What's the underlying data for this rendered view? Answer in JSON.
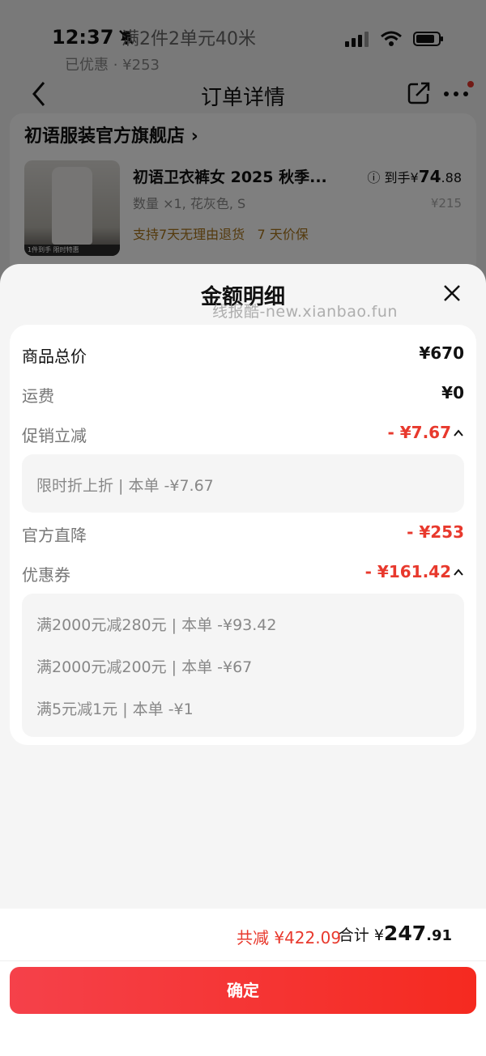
{
  "status_bar": {
    "time": "12:37",
    "ghost_text": "满2件2单元40米",
    "ghost_text2": "已优惠   ·   ¥253"
  },
  "nav": {
    "title": "订单详情"
  },
  "store": {
    "name": "初语服装官方旗舰店",
    "product": {
      "title": "初语卫衣裤女 2025 秋季...",
      "spec": "数量 ×1, 花灰色, S",
      "promo_return": "支持7天无理由退货",
      "promo_price": "7 天价保",
      "price_prefix": "到手",
      "price_currency": "¥",
      "price_int": "74",
      "price_dec": ".88",
      "original_price": "¥215",
      "image_tag": "1件到手 限时特惠"
    }
  },
  "sheet": {
    "title": "金额明细",
    "watermark": "线报酷-new.xianbao.fun",
    "rows": {
      "total_goods": {
        "label": "商品总价",
        "value": "¥670"
      },
      "shipping": {
        "label": "运费",
        "value": "¥0"
      },
      "promo": {
        "label": "促销立减",
        "value": "- ¥7.67"
      },
      "official": {
        "label": "官方直降",
        "value": "- ¥253"
      },
      "coupon": {
        "label": "优惠券",
        "value": "- ¥161.42"
      }
    },
    "promo_details": [
      "限时折上折 | 本单 -¥7.67"
    ],
    "coupon_details": [
      "满2000元减280元 | 本单 -¥93.42",
      "满2000元减200元 | 本单 -¥67",
      "满5元减1元 | 本单 -¥1"
    ]
  },
  "footer": {
    "savings": "共减 ¥422.09",
    "total_label": "合计",
    "total_currency": "¥",
    "total_int": "247",
    "total_dec": ".91",
    "confirm": "确定"
  },
  "colors": {
    "accent_red": "#e8392d",
    "button_start": "#f5414a",
    "button_end": "#f52a20",
    "promo_gold": "#a8741a"
  }
}
